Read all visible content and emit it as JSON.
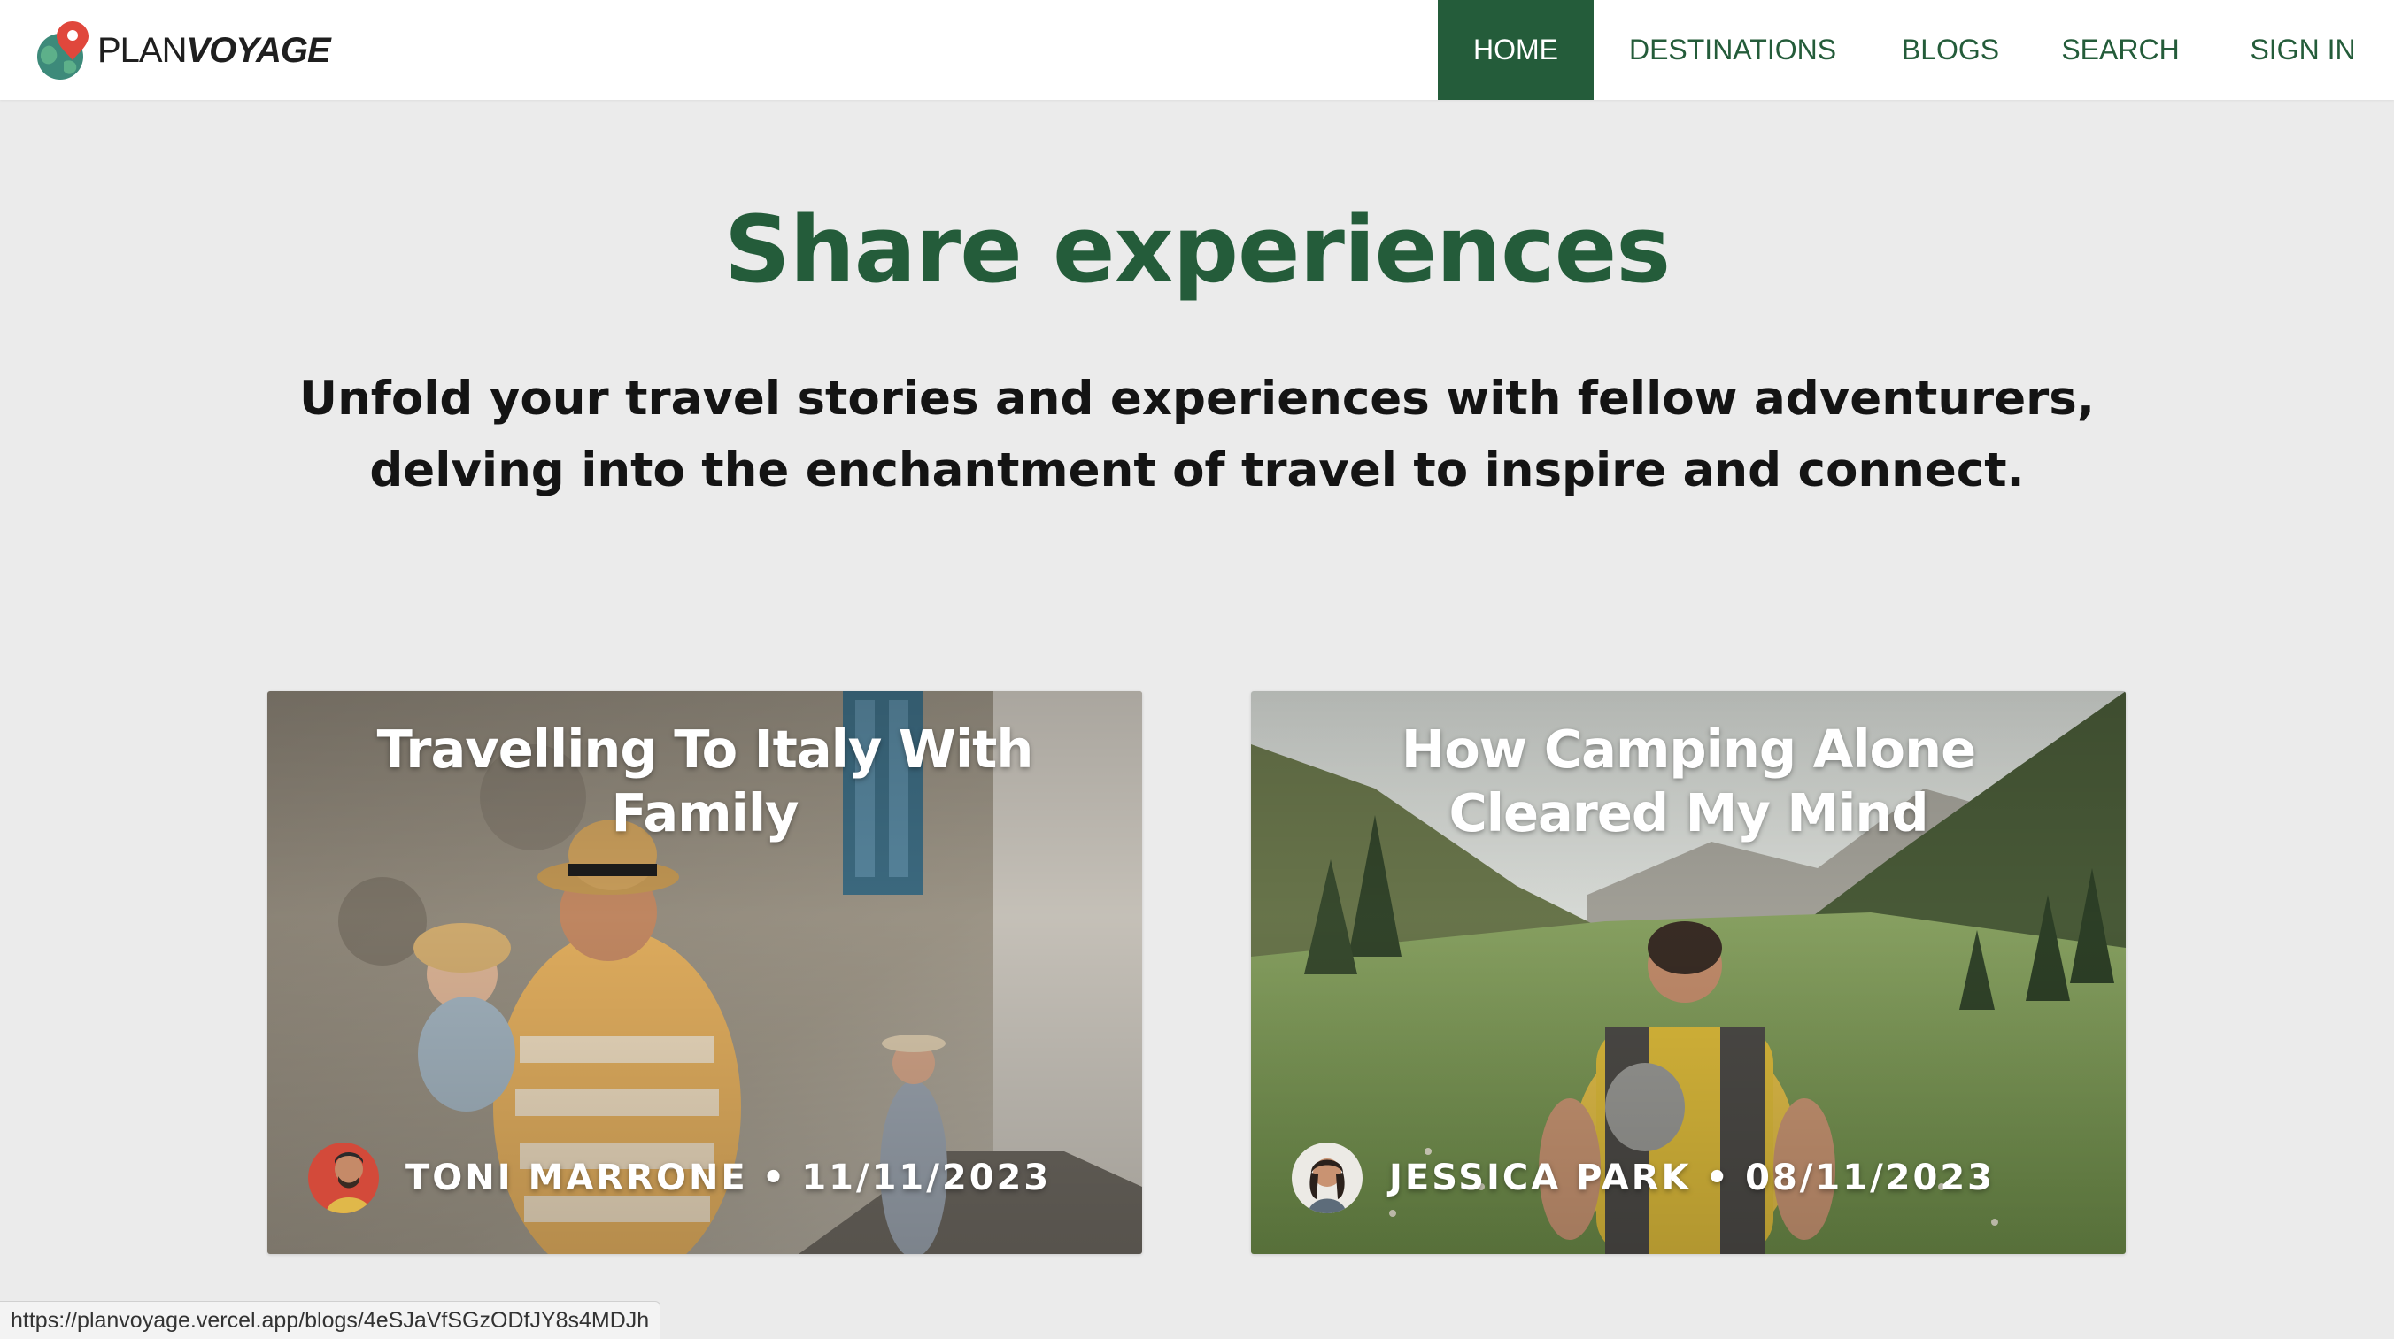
{
  "brand": {
    "name_part1": "PLAN",
    "name_part2": "VOYAGE",
    "logo_icon": "globe-pin-icon",
    "primary_color": "#245c3a"
  },
  "nav": {
    "items": [
      {
        "label": "HOME",
        "active": true
      },
      {
        "label": "DESTINATIONS",
        "active": false
      },
      {
        "label": "BLOGS",
        "active": false
      },
      {
        "label": "SEARCH",
        "active": false
      },
      {
        "label": "SIGN IN",
        "active": false
      }
    ]
  },
  "hero": {
    "title": "Share experiences",
    "subtitle": "Unfold your travel stories and experiences with fellow adventurers, delving into the enchantment of travel to inspire and connect."
  },
  "posts": [
    {
      "title": "Travelling To Italy With Family",
      "author": "TONI MARRONE",
      "separator": "•",
      "date": "11/11/2023"
    },
    {
      "title": "How Camping Alone Cleared My Mind",
      "author": "JESSICA PARK",
      "separator": "•",
      "date": "08/11/2023"
    }
  ],
  "status_bar": {
    "url": "https://planvoyage.vercel.app/blogs/4eSJaVfSGzODfJY8s4MDJh"
  }
}
